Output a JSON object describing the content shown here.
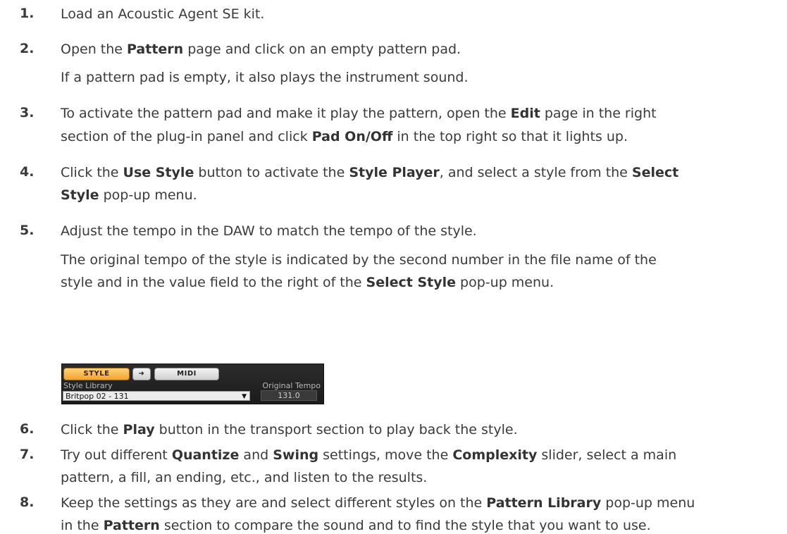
{
  "steps": [
    {
      "number": "1.",
      "lines": [
        [
          {
            "t": "Load an Acoustic Agent SE kit."
          }
        ]
      ]
    },
    {
      "number": "2.",
      "lines": [
        [
          {
            "t": "Open the "
          },
          {
            "t": "Pattern",
            "b": true
          },
          {
            "t": " page and click on an empty pattern pad."
          }
        ],
        [
          {
            "t": "If a pattern pad is empty, it also plays the instrument sound."
          }
        ]
      ]
    },
    {
      "number": "3.",
      "lines": [
        [
          {
            "t": "To activate the pattern pad and make it play the pattern, open the "
          },
          {
            "t": "Edit",
            "b": true
          },
          {
            "t": " page in the right"
          }
        ],
        [
          {
            "t": "section of the plug-in panel and click "
          },
          {
            "t": "Pad On/Off",
            "b": true
          },
          {
            "t": " in the top right so that it lights up."
          }
        ]
      ]
    },
    {
      "number": "4.",
      "lines": [
        [
          {
            "t": "Click the "
          },
          {
            "t": "Use Style",
            "b": true
          },
          {
            "t": " button to activate the "
          },
          {
            "t": "Style Player",
            "b": true
          },
          {
            "t": ", and select a style from the "
          },
          {
            "t": "Select",
            "b": true
          }
        ],
        [
          {
            "t": "Style",
            "b": true
          },
          {
            "t": " pop-up menu."
          }
        ]
      ]
    },
    {
      "number": "5.",
      "lines": [
        [
          {
            "t": "Adjust the tempo in the DAW to match the tempo of the style."
          }
        ],
        [
          {
            "t": "The original tempo of the style is indicated by the second number in the file name of the"
          }
        ],
        [
          {
            "t": "style and in the value field to the right of the "
          },
          {
            "t": "Select Style",
            "b": true
          },
          {
            "t": " pop-up menu."
          }
        ]
      ]
    },
    {
      "number": "6.",
      "lines": [
        [
          {
            "t": "Click the "
          },
          {
            "t": "Play",
            "b": true
          },
          {
            "t": " button in the transport section to play back the style."
          }
        ]
      ]
    },
    {
      "number": "7.",
      "lines": [
        [
          {
            "t": "Try out different "
          },
          {
            "t": "Quantize",
            "b": true
          },
          {
            "t": " and "
          },
          {
            "t": "Swing",
            "b": true
          },
          {
            "t": " settings, move the "
          },
          {
            "t": "Complexity",
            "b": true
          },
          {
            "t": " slider, select a main"
          }
        ],
        [
          {
            "t": "pattern, a fill, an ending, etc., and listen to the results."
          }
        ]
      ]
    },
    {
      "number": "8.",
      "lines": [
        [
          {
            "t": "Keep the settings as they are and select different styles on the "
          },
          {
            "t": "Pattern Library",
            "b": true
          },
          {
            "t": " pop-up menu"
          }
        ],
        [
          {
            "t": "in the "
          },
          {
            "t": "Pattern",
            "b": true
          },
          {
            "t": " section to compare the sound and to find the style that you want to use."
          }
        ]
      ]
    }
  ],
  "widget": {
    "style_button": "STYLE",
    "arrow_button": "➜",
    "midi_button": "MIDI",
    "style_library_label": "Style Library",
    "original_tempo_label": "Original Tempo",
    "selected_style": "Britpop 02 - 131",
    "dropdown_arrow": "▼",
    "tempo_value": "131.0"
  }
}
